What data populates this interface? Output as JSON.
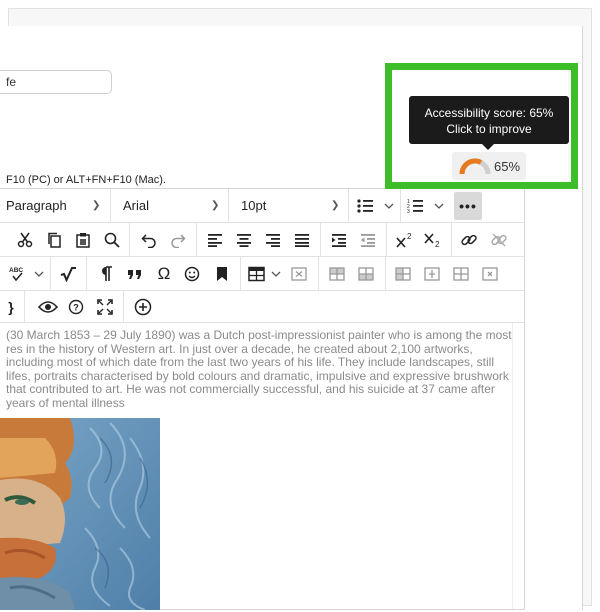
{
  "form": {
    "title_value": "fe",
    "shortcut_hint": "F10 (PC) or ALT+FN+F10 (Mac)."
  },
  "accessibility": {
    "tooltip_line1": "Accessibility score: 65%",
    "tooltip_line2": "Click to improve",
    "score": "65%",
    "score_value": 65,
    "gauge_colors": {
      "filled": "#e67a1e",
      "empty": "#cfcfcf"
    },
    "highlight_color": "#3dbd2a"
  },
  "toolbar": {
    "block_format": "Paragraph",
    "font_family": "Arial",
    "font_size": "10pt",
    "more_label": "•••",
    "row2_icons": [
      "cut-icon",
      "copy-icon",
      "paste-icon",
      "find-icon",
      "undo-icon",
      "redo-icon",
      "align-left-icon",
      "align-center-icon",
      "align-right-icon",
      "align-justify-icon",
      "indent-icon",
      "outdent-icon",
      "superscript-icon",
      "subscript-icon",
      "link-icon",
      "unlink-icon"
    ],
    "row3_icons": [
      "spellcheck-icon",
      "math-icon",
      "paragraph-mark-icon",
      "quote-icon",
      "omega-icon",
      "emoji-icon",
      "bookmark-icon",
      "table-icon",
      "delete-table-icon",
      "insert-row-icon",
      "delete-row-icon",
      "insert-col-before-icon",
      "insert-col-after-icon",
      "insert-col-icon",
      "delete-col-icon"
    ],
    "row4_icons": [
      "source-code-icon",
      "preview-icon",
      "help-icon",
      "fullscreen-icon",
      "add-content-icon"
    ]
  },
  "content": {
    "text": "(30 March 1853 – 29 July 1890) was a Dutch post-impressionist painter who is among the most res in the history of Western art. In just over a decade, he created about 2,100 artworks, including most of which date from the last two years of his life. They include landscapes, still lifes, portraits characterised by bold colours and dramatic, impulsive and expressive brushwork that contributed to art. He was not commercially successful, and his suicide at 37 came after years of mental illness"
  }
}
